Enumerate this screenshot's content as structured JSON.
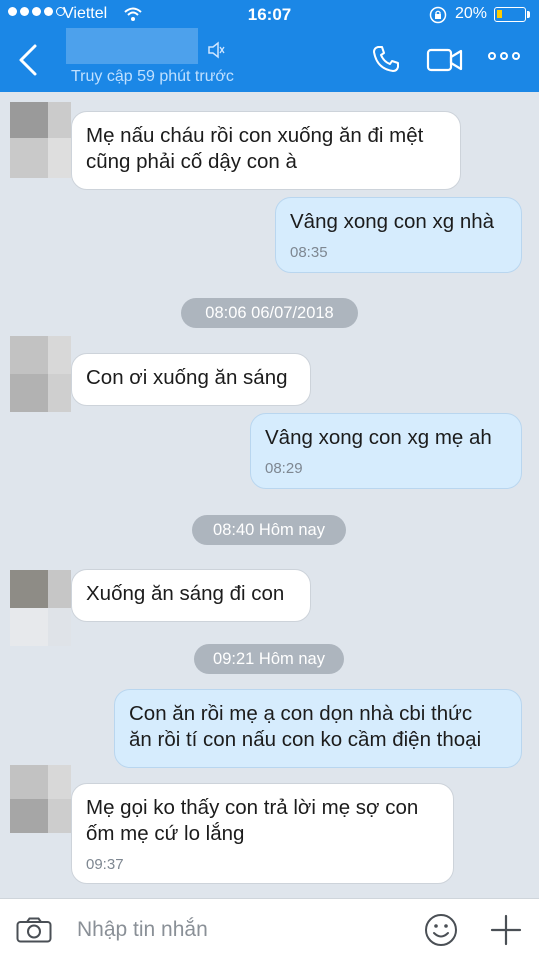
{
  "status_bar": {
    "carrier": "Viettel",
    "time": "16:07",
    "battery_percent": "20%",
    "battery_level": 0.2,
    "signal_bars": 4,
    "signal_max": 5
  },
  "header": {
    "subtitle": "Truy cập 59 phút trước",
    "accent_color": "#1b87e6"
  },
  "messages": [
    {
      "direction": "in",
      "line1": "Mẹ nấu cháu rồi con xuống ăn đi mệt",
      "line2": "cũng phải cố dậy con à"
    },
    {
      "direction": "out",
      "line1": "Vâng xong con xg nhà",
      "time": "08:35"
    },
    {
      "separator": "08:06 06/07/2018"
    },
    {
      "direction": "in",
      "line1": "Con ơi xuống ăn sáng"
    },
    {
      "direction": "out",
      "line1": "Vâng xong con xg mẹ ah",
      "time": "08:29"
    },
    {
      "separator": "08:40 Hôm nay"
    },
    {
      "direction": "in",
      "line1": "Xuống ăn sáng đi con"
    },
    {
      "separator": "09:21 Hôm nay"
    },
    {
      "direction": "out",
      "line1": "Con ăn rồi mẹ ạ con dọn nhà cbi thức",
      "line2": "ăn rồi tí con nấu con ko cầm điện thoại"
    },
    {
      "direction": "in",
      "line1": "Mẹ gọi ko thấy con trả lời mẹ sợ con",
      "line2": "ốm mẹ cứ lo lắng",
      "time": "09:37"
    }
  ],
  "composer": {
    "placeholder": "Nhập tin nhắn"
  }
}
